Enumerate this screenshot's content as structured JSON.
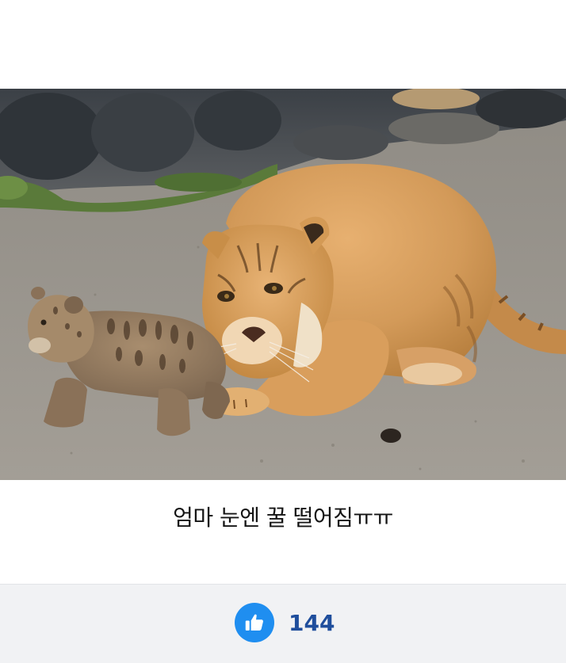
{
  "post": {
    "photo_alt": "mother-liger-and-cub",
    "caption": "엄마 눈엔 꿀 떨어짐ㅠㅠ"
  },
  "reactions": {
    "like_icon": "thumbs-up-icon",
    "like_count": "144",
    "accent_color": "#1f8ef0"
  }
}
